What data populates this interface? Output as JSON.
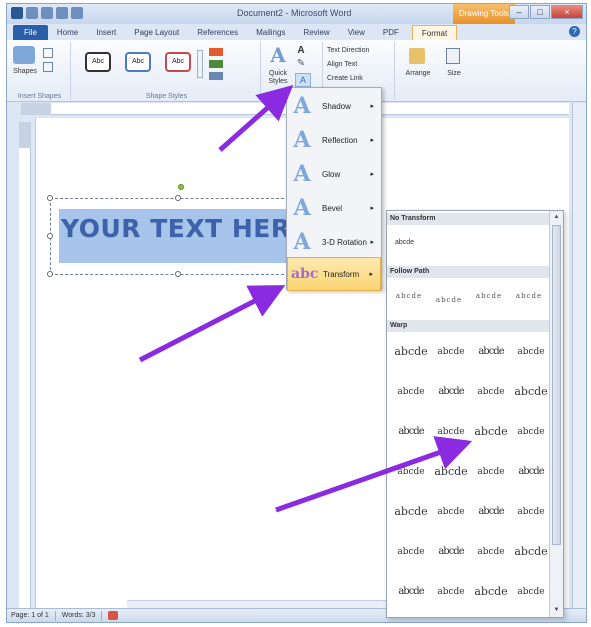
{
  "window": {
    "title": "Document2 - Microsoft Word",
    "context_tab_group": "Drawing Tools",
    "buttons": {
      "minimize": "–",
      "maximize": "□",
      "close": "×"
    }
  },
  "tabs": [
    "File",
    "Home",
    "Insert",
    "Page Layout",
    "References",
    "Mailings",
    "Review",
    "View",
    "PDF",
    "Format"
  ],
  "help_label": "?",
  "ribbon": {
    "shapes_label": "Shapes",
    "insert_shapes_group": "Insert Shapes",
    "shape_styles_group": "Shape Styles",
    "abc_samples": [
      "Abc",
      "Abc",
      "Abc"
    ],
    "quick_styles_label": "Quick Styles",
    "wordart_group": "W",
    "text_direction": "Text Direction",
    "align_text": "Align Text",
    "create_link": "Create Link",
    "arrange": "Arrange",
    "size": "Size"
  },
  "document": {
    "wordart_text": "YOUR TEXT HER"
  },
  "effects_menu": {
    "items": [
      {
        "label": "Shadow",
        "icon": "text-effect-shadow-icon"
      },
      {
        "label": "Reflection",
        "icon": "text-effect-reflection-icon"
      },
      {
        "label": "Glow",
        "icon": "text-effect-glow-icon"
      },
      {
        "label": "Bevel",
        "icon": "text-effect-bevel-icon"
      },
      {
        "label": "3-D Rotation",
        "icon": "text-effect-3d-rotation-icon"
      },
      {
        "label": "Transform",
        "icon": "text-effect-transform-icon",
        "active": true
      }
    ],
    "arrow_glyph": "▸"
  },
  "transform_gallery": {
    "no_transform_header": "No Transform",
    "no_transform_sample": "abcde",
    "follow_path_header": "Follow Path",
    "warp_header": "Warp",
    "path_samples": [
      "abcde",
      "abcde",
      "abcde",
      "abcde"
    ],
    "warp_rows": [
      [
        "abcde",
        "abcde",
        "abcde",
        "abcde"
      ],
      [
        "abcde",
        "abcde",
        "abcde",
        "abcde"
      ],
      [
        "abcde",
        "abcde",
        "abcde",
        "abcde"
      ],
      [
        "abcde",
        "abcde",
        "abcde",
        "abcde"
      ],
      [
        "abcde",
        "abcde",
        "abcde",
        "abcde"
      ],
      [
        "abcde",
        "abcde",
        "abcde",
        "abcde"
      ],
      [
        "abcde",
        "abcde",
        "abcde",
        "abcde"
      ]
    ]
  },
  "status_bar": {
    "page": "Page: 1 of 1",
    "words": "Words: 3/3"
  },
  "colors": {
    "accent": "#2a5ea9",
    "context_tab": "#e8912a",
    "annotation_arrow": "#8a2be2",
    "wordart_text": "#3d62ab"
  }
}
